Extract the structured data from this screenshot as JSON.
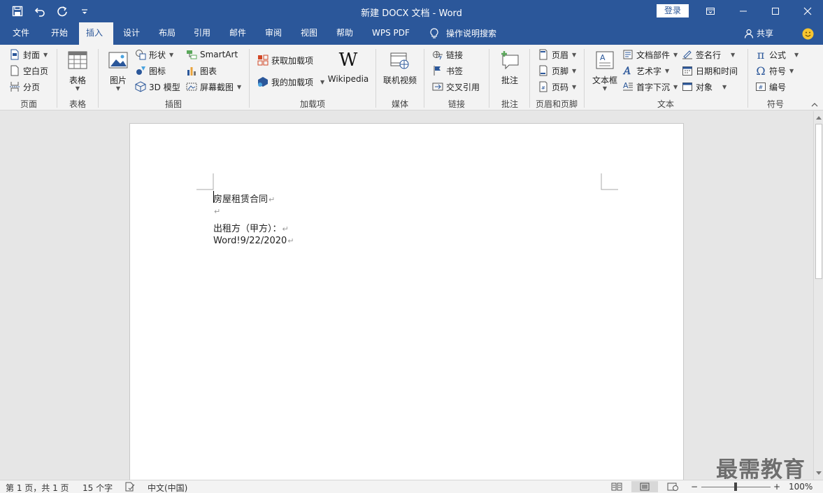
{
  "window": {
    "title": "新建 DOCX 文档 - Word",
    "login": "登录"
  },
  "tabs": [
    "文件",
    "开始",
    "插入",
    "设计",
    "布局",
    "引用",
    "邮件",
    "审阅",
    "视图",
    "帮助",
    "WPS PDF",
    "操作说明搜索"
  ],
  "active_tab": "插入",
  "share": "共享",
  "ribbon": {
    "page": {
      "label": "页面",
      "cover": "封面",
      "blank": "空白页",
      "break": "分页"
    },
    "table": {
      "label": "表格",
      "table": "表格"
    },
    "illustrations": {
      "label": "插图",
      "picture": "图片",
      "shapes": "形状",
      "icons": "图标",
      "model3d": "3D 模型",
      "smartart": "SmartArt",
      "chart": "图表",
      "screenshot": "屏幕截图"
    },
    "addins": {
      "label": "加载项",
      "get": "获取加载项",
      "my": "我的加载项",
      "wikipedia": "Wikipedia"
    },
    "media": {
      "label": "媒体",
      "video": "联机视频"
    },
    "links": {
      "label": "链接",
      "link": "链接",
      "bookmark": "书签",
      "crossref": "交叉引用"
    },
    "comments": {
      "label": "批注",
      "comment": "批注"
    },
    "headerfooter": {
      "label": "页眉和页脚",
      "header": "页眉",
      "footer": "页脚",
      "pagenum": "页码"
    },
    "text": {
      "label": "文本",
      "textbox": "文本框",
      "quickparts": "文档部件",
      "wordart": "艺术字",
      "dropcap": "首字下沉",
      "signature": "签名行",
      "datetime": "日期和时间",
      "object": "对象"
    },
    "symbols": {
      "label": "符号",
      "equation": "公式",
      "symbol": "符号",
      "number": "编号"
    }
  },
  "document": {
    "lines": [
      "房屋租赁合同",
      "",
      "出租方（甲方）：",
      "Word!9/22/2020"
    ]
  },
  "status": {
    "page": "第 1 页，共 1 页",
    "words": "15 个字",
    "language": "中文(中国)",
    "zoom": "100%",
    "zoom_minus": "−",
    "zoom_plus": "+"
  },
  "watermark": "最需教育",
  "colors": {
    "accent": "#2b579a",
    "ribbon_bg": "#f3f3f3",
    "doc_bg": "#e6e6e6"
  }
}
